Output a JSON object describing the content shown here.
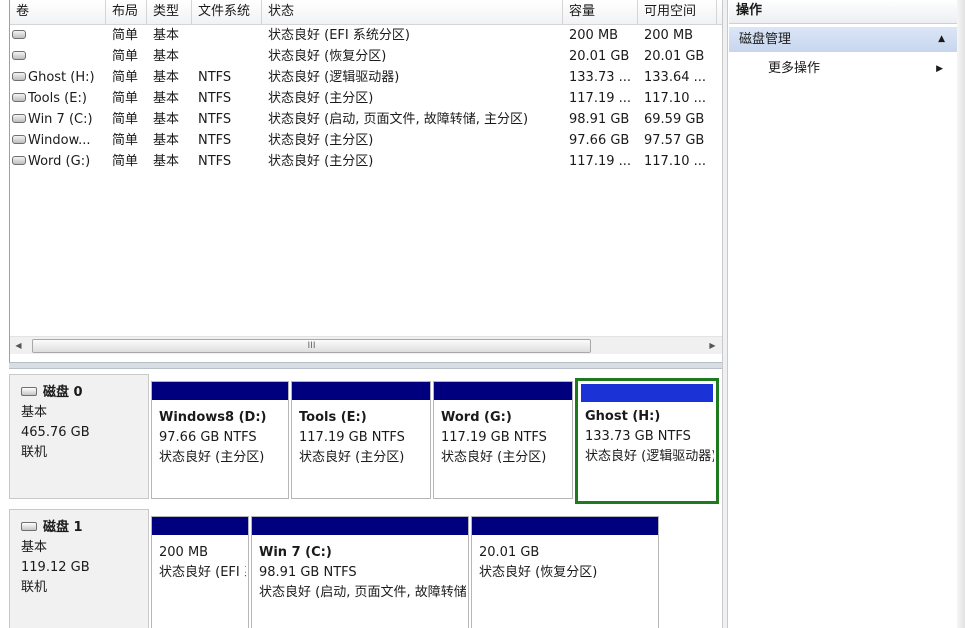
{
  "columns": [
    "卷",
    "布局",
    "类型",
    "文件系统",
    "状态",
    "容量",
    "可用空间"
  ],
  "volumes": [
    {
      "name": "",
      "layout": "简单",
      "type": "基本",
      "fs": "",
      "status": "状态良好 (EFI 系统分区)",
      "capacity": "200 MB",
      "free": "200 MB"
    },
    {
      "name": "",
      "layout": "简单",
      "type": "基本",
      "fs": "",
      "status": "状态良好 (恢复分区)",
      "capacity": "20.01 GB",
      "free": "20.01 GB"
    },
    {
      "name": "Ghost (H:)",
      "layout": "简单",
      "type": "基本",
      "fs": "NTFS",
      "status": "状态良好 (逻辑驱动器)",
      "capacity": "133.73 ...",
      "free": "133.64 ..."
    },
    {
      "name": "Tools (E:)",
      "layout": "简单",
      "type": "基本",
      "fs": "NTFS",
      "status": "状态良好 (主分区)",
      "capacity": "117.19 ...",
      "free": "117.10 ..."
    },
    {
      "name": "Win 7 (C:)",
      "layout": "简单",
      "type": "基本",
      "fs": "NTFS",
      "status": "状态良好 (启动, 页面文件, 故障转储, 主分区)",
      "capacity": "98.91 GB",
      "free": "69.59 GB"
    },
    {
      "name": "Window...",
      "layout": "简单",
      "type": "基本",
      "fs": "NTFS",
      "status": "状态良好 (主分区)",
      "capacity": "97.66 GB",
      "free": "97.57 GB"
    },
    {
      "name": "Word (G:)",
      "layout": "简单",
      "type": "基本",
      "fs": "NTFS",
      "status": "状态良好 (主分区)",
      "capacity": "117.19 ...",
      "free": "117.10 ..."
    }
  ],
  "scrollbar": {
    "thumb_grip": "III",
    "left_arrow": "◀",
    "right_arrow": "▶"
  },
  "disks": [
    {
      "title": "磁盘 0",
      "type": "基本",
      "size": "465.76 GB",
      "state": "联机",
      "partitions": [
        {
          "name": "Windows8  (D:)",
          "size": "97.66 GB NTFS",
          "status": "状态良好 (主分区)"
        },
        {
          "name": "Tools  (E:)",
          "size": "117.19 GB NTFS",
          "status": "状态良好 (主分区)"
        },
        {
          "name": "Word  (G:)",
          "size": "117.19 GB NTFS",
          "status": "状态良好 (主分区)"
        },
        {
          "name": "Ghost  (H:)",
          "size": "133.73 GB NTFS",
          "status": "状态良好 (逻辑驱动器)",
          "selected": true
        }
      ]
    },
    {
      "title": "磁盘 1",
      "type": "基本",
      "size": "119.12 GB",
      "state": "联机",
      "partitions": [
        {
          "name": "",
          "size": "200 MB",
          "status": "状态良好 (EFI 系统分区)"
        },
        {
          "name": "Win 7  (C:)",
          "size": "98.91 GB NTFS",
          "status": "状态良好 (启动, 页面文件, 故障转储, 主分区)"
        },
        {
          "name": "",
          "size": "20.01 GB",
          "status": "状态良好 (恢复分区)"
        }
      ]
    }
  ],
  "actions": {
    "title": "操作",
    "section": "磁盘管理",
    "section_caret": "▲",
    "more": "更多操作",
    "more_caret": "▶"
  },
  "colors": {
    "partition_bar": "#00007e",
    "selected_bar": "#1b33d6",
    "selection_border": "#1f7a1f",
    "section_bg": "#c7d6ee"
  }
}
